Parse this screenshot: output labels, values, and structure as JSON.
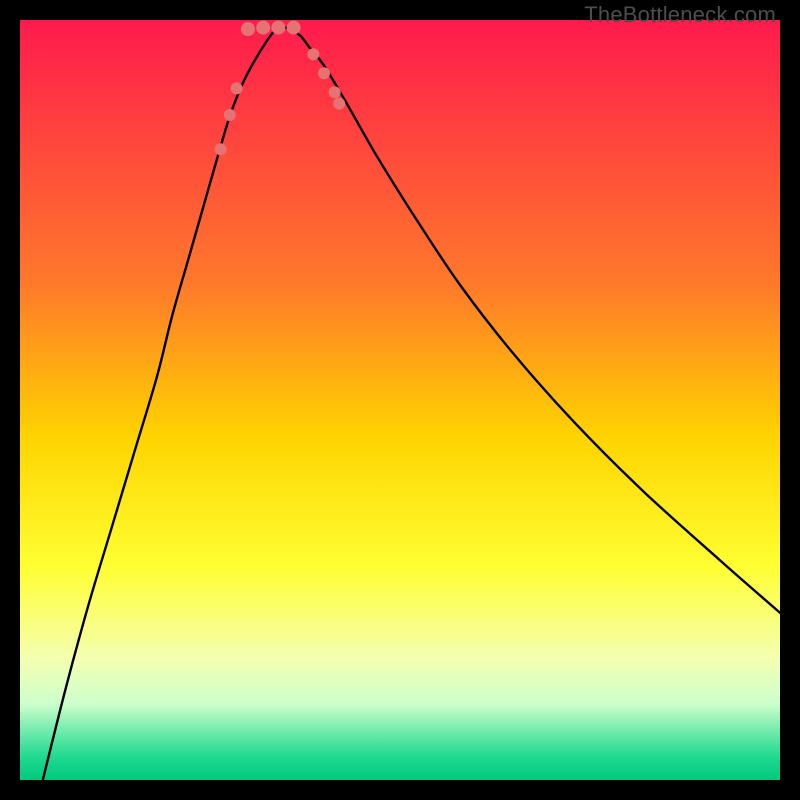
{
  "watermark": "TheBottleneck.com",
  "chart_data": {
    "type": "line",
    "title": "",
    "xlabel": "",
    "ylabel": "",
    "xlim": [
      0,
      100
    ],
    "ylim": [
      0,
      100
    ],
    "gradient_stops": [
      {
        "offset": 0,
        "color": "#ff1a4d"
      },
      {
        "offset": 35,
        "color": "#ff7a2a"
      },
      {
        "offset": 55,
        "color": "#ffd400"
      },
      {
        "offset": 72,
        "color": "#ffff33"
      },
      {
        "offset": 84,
        "color": "#f5ffb0"
      },
      {
        "offset": 90,
        "color": "#ccffcc"
      },
      {
        "offset": 94,
        "color": "#66e9a8"
      },
      {
        "offset": 97,
        "color": "#1fd990"
      },
      {
        "offset": 100,
        "color": "#00c97d"
      }
    ],
    "series": [
      {
        "name": "bottleneck-curve",
        "x": [
          3,
          6,
          9,
          12,
          15,
          18,
          20,
          22,
          24,
          26,
          27.5,
          29,
          30.5,
          32,
          33,
          34,
          35,
          36.8,
          38,
          40,
          43,
          47,
          52,
          58,
          65,
          73,
          82,
          92,
          100
        ],
        "y": [
          0,
          12,
          23,
          33,
          43,
          53,
          61,
          68,
          75,
          82,
          87,
          91,
          94,
          96.5,
          98,
          99,
          99,
          98,
          96.5,
          94,
          89,
          82,
          74,
          65,
          56,
          47,
          38,
          29,
          22
        ]
      }
    ],
    "markers": {
      "name": "highlight-dots",
      "color": "#e57373",
      "points": [
        {
          "x": 26.4,
          "y": 83
        },
        {
          "x": 27.6,
          "y": 87.5
        },
        {
          "x": 28.5,
          "y": 91
        },
        {
          "x": 30.0,
          "y": 98.8,
          "r": 7
        },
        {
          "x": 32.0,
          "y": 99.0,
          "r": 7
        },
        {
          "x": 34.0,
          "y": 99.0,
          "r": 7
        },
        {
          "x": 36.0,
          "y": 99.0,
          "r": 7
        },
        {
          "x": 38.6,
          "y": 95.5
        },
        {
          "x": 40.0,
          "y": 93
        },
        {
          "x": 41.4,
          "y": 90.5
        },
        {
          "x": 42.0,
          "y": 89
        }
      ],
      "default_radius": 6
    }
  }
}
